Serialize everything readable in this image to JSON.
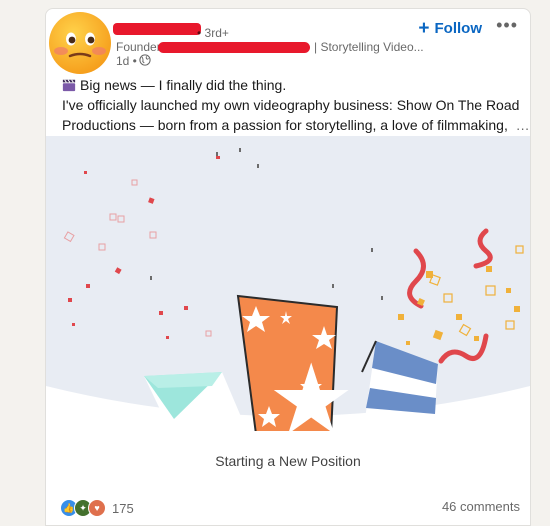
{
  "post": {
    "author": {
      "degree": "• 3rd+",
      "headline_prefix": "Founder",
      "headline_suffix": "| Storytelling Video...",
      "time": "1d •",
      "visibility_icon": "globe-icon"
    },
    "follow_label": "Follow",
    "more_options_icon": "ellipsis-icon",
    "text": {
      "line1": "Big news — I finally did the thing.",
      "line2": "I've officially launched my own videography business: Show On The Road",
      "line3": "Productions — born from a passion for storytelling, a love of filmmaking,",
      "see_more": "…more"
    },
    "media_caption": "Starting a New Position",
    "reactions": {
      "count": "175",
      "icons": [
        "like-icon",
        "celebrate-icon",
        "love-icon"
      ]
    },
    "comments": "46 comments"
  },
  "colors": {
    "accent": "#0a66c2",
    "orange_card": "#f4894b",
    "blue_card": "#6a8ec8",
    "teal_card": "#9de6dc",
    "confetti_red": "#e0474c",
    "confetti_gold": "#f0b13a"
  }
}
